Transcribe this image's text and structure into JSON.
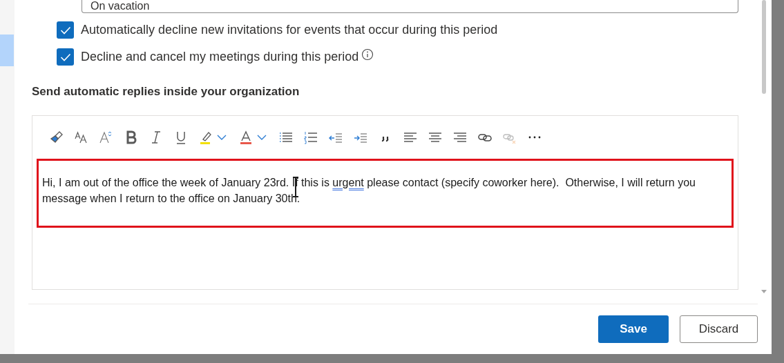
{
  "reason_field": {
    "value": "On vacation"
  },
  "options": [
    {
      "label": "Automatically decline new invitations for events that occur during this period",
      "checked": true,
      "info": false
    },
    {
      "label": "Decline and cancel my meetings during this period",
      "checked": true,
      "info": true
    }
  ],
  "section_heading": "Send automatic replies inside your organization",
  "toolbar": [
    {
      "kind": "painter",
      "disabled": false
    },
    {
      "kind": "fontsize",
      "disabled": false
    },
    {
      "kind": "grow",
      "disabled": false
    },
    {
      "kind": "bold",
      "disabled": false
    },
    {
      "kind": "italic",
      "disabled": false
    },
    {
      "kind": "underline",
      "disabled": false
    },
    {
      "kind": "highlight",
      "disabled": false
    },
    {
      "kind": "caret",
      "disabled": false
    },
    {
      "kind": "fontcolor",
      "disabled": false
    },
    {
      "kind": "caret",
      "disabled": false
    },
    {
      "kind": "bullets",
      "disabled": false
    },
    {
      "kind": "numbers",
      "disabled": false
    },
    {
      "kind": "outdent",
      "disabled": false
    },
    {
      "kind": "indent",
      "disabled": false
    },
    {
      "kind": "quote",
      "disabled": false
    },
    {
      "kind": "left",
      "disabled": false
    },
    {
      "kind": "center",
      "disabled": false
    },
    {
      "kind": "right",
      "disabled": false
    },
    {
      "kind": "link",
      "disabled": false
    },
    {
      "kind": "unlink",
      "disabled": true
    },
    {
      "kind": "more",
      "disabled": false
    }
  ],
  "message": [
    {
      "text": "Hi, I am out of the office the week of January 23rd. If this is ",
      "flagged": false
    },
    {
      "text": "urgent",
      "flagged": true
    },
    {
      "text": " please contact (specify coworker here).  Otherwise, I will return you message when I return to the office on January 30th.",
      "flagged": false
    }
  ],
  "buttons": [
    {
      "label": "Save",
      "kind": "primary"
    },
    {
      "label": "Discard",
      "kind": "secondary"
    }
  ]
}
